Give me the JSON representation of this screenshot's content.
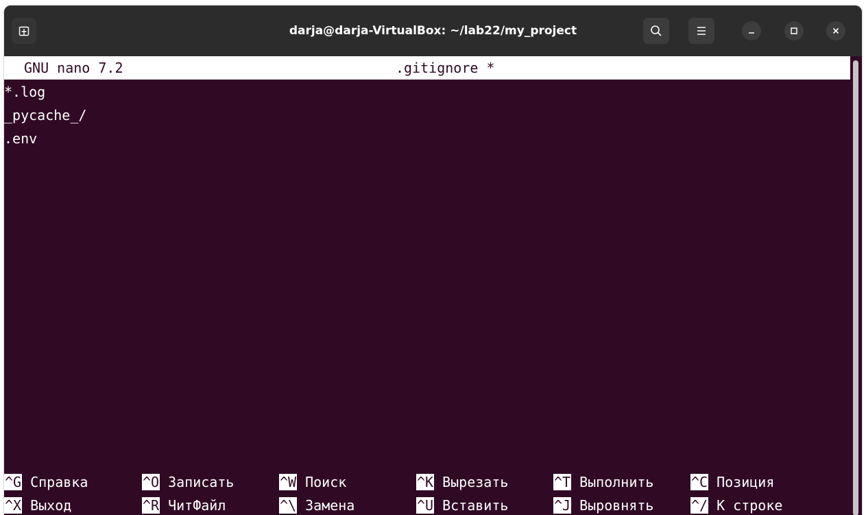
{
  "window": {
    "title": "darja@darja-VirtualBox: ~/lab22/my_project"
  },
  "titlebar": {
    "new_tab_icon": "new-tab-icon",
    "search_icon": "search-icon",
    "menu_icon": "hamburger-menu-icon",
    "minimize_icon": "minimize-icon",
    "maximize_icon": "maximize-icon",
    "close_icon": "close-icon"
  },
  "nano": {
    "version": "GNU nano 7.2",
    "filename": ".gitignore *",
    "lines": [
      "*.log",
      "_pycache_/",
      ".env"
    ]
  },
  "shortcuts": {
    "row1": [
      {
        "key": "^G",
        "label": "Справка"
      },
      {
        "key": "^O",
        "label": "Записать"
      },
      {
        "key": "^W",
        "label": "Поиск"
      },
      {
        "key": "^K",
        "label": "Вырезать"
      },
      {
        "key": "^T",
        "label": "Выполнить"
      },
      {
        "key": "^C",
        "label": "Позиция"
      }
    ],
    "row2": [
      {
        "key": "^X",
        "label": "Выход"
      },
      {
        "key": "^R",
        "label": "ЧитФайл"
      },
      {
        "key": "^\\",
        "label": "Замена"
      },
      {
        "key": "^U",
        "label": "Вставить"
      },
      {
        "key": "^J",
        "label": "Выровнять"
      },
      {
        "key": "^/",
        "label": "К строке"
      }
    ]
  },
  "colors": {
    "terminal_bg": "#300a24",
    "titlebar_bg": "#2c2c2c",
    "text": "#ffffff"
  }
}
